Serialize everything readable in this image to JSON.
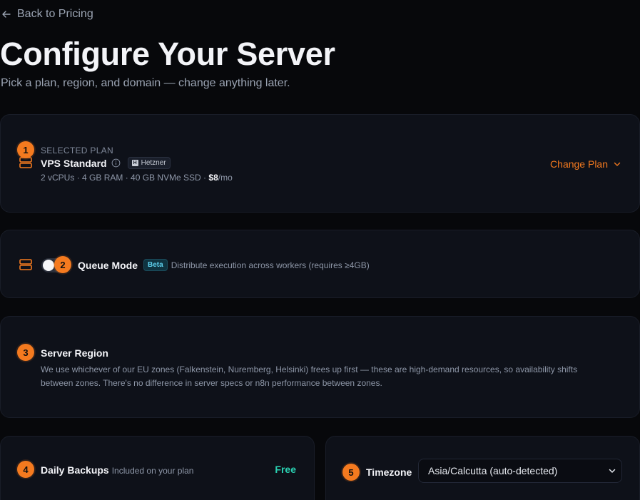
{
  "nav": {
    "back_label": "Back to Pricing"
  },
  "header": {
    "title": "Configure Your Server",
    "subtitle": "Pick a plan, region, and domain — change anything later."
  },
  "plan": {
    "step": "1",
    "eyebrow": "SELECTED PLAN",
    "name": "VPS Standard",
    "provider": "Hetzner",
    "specs": "2 vCPUs · 4 GB RAM · 40 GB NVMe SSD · ",
    "price": "$8",
    "price_unit": "/mo",
    "change_label": "Change Plan"
  },
  "queue": {
    "step": "2",
    "label": "Queue Mode",
    "badge": "Beta",
    "description": "Distribute execution across workers (requires ≥4GB)",
    "enabled": false
  },
  "region": {
    "step": "3",
    "title": "Server Region",
    "description": "We use whichever of our EU zones (Falkenstein, Nuremberg, Helsinki) frees up first — these are high-demand resources, so availability shifts between zones. There's no difference in server specs or n8n performance between zones."
  },
  "backups": {
    "step": "4",
    "label": "Daily Backups",
    "note": "Included on your plan",
    "price_label": "Free"
  },
  "timezone": {
    "step": "5",
    "label": "Timezone",
    "selected": "Asia/Calcutta (auto-detected)"
  },
  "colors": {
    "accent": "#f47a1f",
    "free": "#2ad1b2",
    "beta": "#5ed1ee",
    "background": "#07080b",
    "card": "#0e1119"
  },
  "icons": [
    "arrow-left-icon",
    "server-icon",
    "info-icon",
    "hetzner-logo-icon",
    "chevron-down-icon"
  ]
}
